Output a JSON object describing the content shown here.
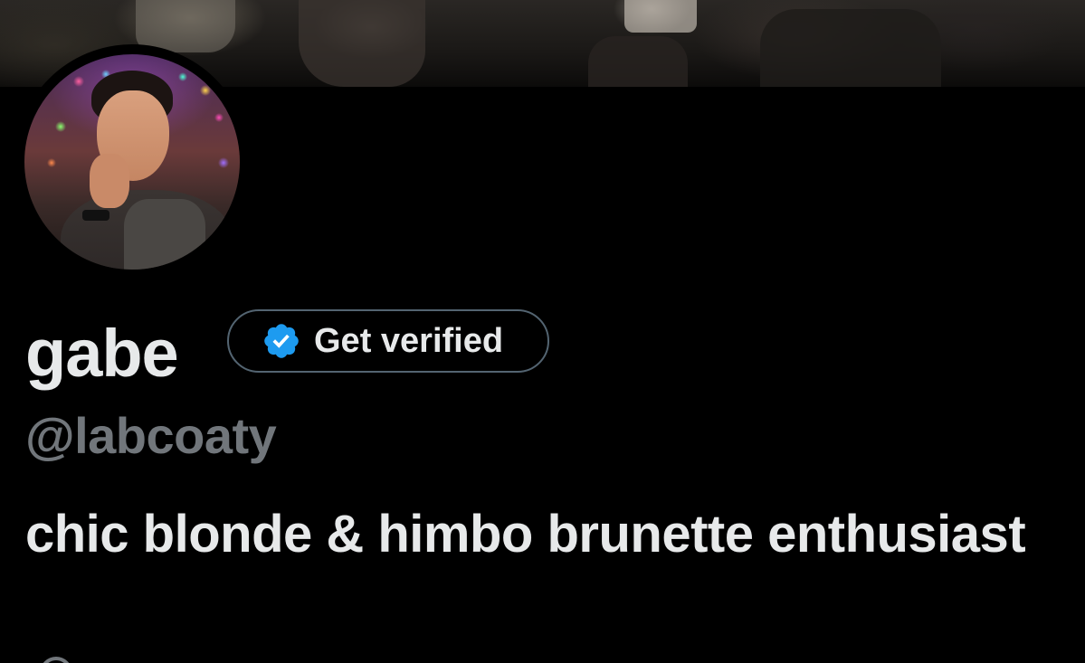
{
  "banner": {
    "icon": "header-photo"
  },
  "avatar": {
    "icon": "profile-photo"
  },
  "profile": {
    "display_name": "gabe",
    "handle": "@labcoaty",
    "bio": "chic blonde & himbo brunette enthusiast"
  },
  "verify_button": {
    "label": "Get verified",
    "icon": "verified-badge-icon",
    "badge_color": "#1d9bf0"
  },
  "colors": {
    "background": "#000000",
    "primary_text": "#e7e9ea",
    "secondary_text": "#71767b",
    "button_border": "#536471"
  }
}
